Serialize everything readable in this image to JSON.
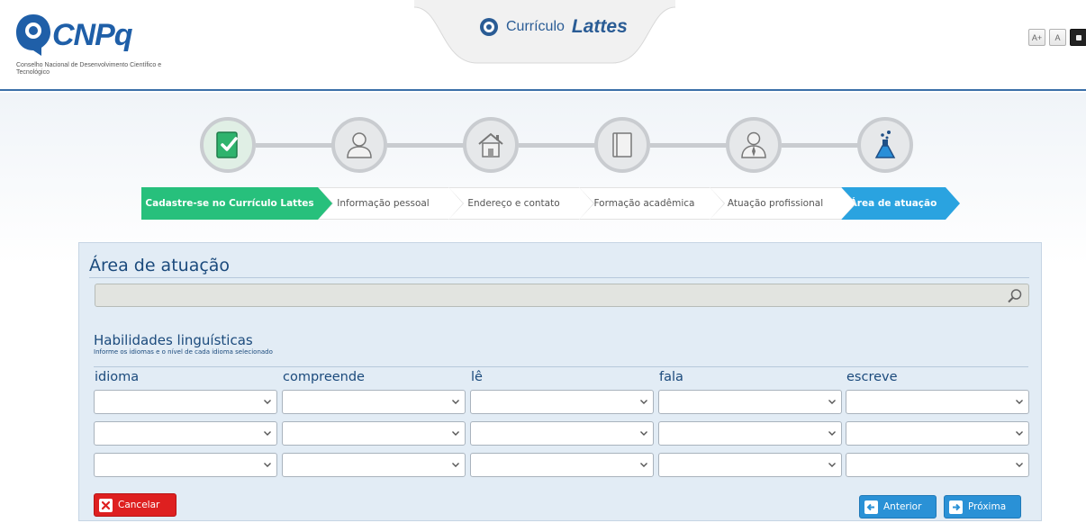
{
  "header": {
    "logo_text": "CNPq",
    "logo_subtitle": "Conselho Nacional de Desenvolvimento Científico e Tecnológico",
    "app_title_prefix": "Currículo",
    "app_title_name": "Lattes",
    "font_controls": [
      "A+",
      "A",
      ""
    ]
  },
  "wizard": {
    "icons": [
      "document-check-icon",
      "person-icon",
      "house-icon",
      "book-icon",
      "professional-icon",
      "flask-icon"
    ],
    "steps": [
      {
        "label": "Cadastre-se no Currículo Lattes",
        "state": "done"
      },
      {
        "label": "Informação pessoal",
        "state": "todo"
      },
      {
        "label": "Endereço e contato",
        "state": "todo"
      },
      {
        "label": "Formação acadêmica",
        "state": "todo"
      },
      {
        "label": "Atuação profissional",
        "state": "todo"
      },
      {
        "label": "Área de atuação",
        "state": "current"
      }
    ]
  },
  "form": {
    "area_title": "Área de atuação",
    "area_search_value": "",
    "hab_title": "Habilidades linguísticas",
    "hab_subtitle": "Informe os idiomas e o nível de cada idioma selecionado",
    "columns": [
      "idioma",
      "compreende",
      "lê",
      "fala",
      "escreve"
    ],
    "rows": [
      [
        "",
        "",
        "",
        "",
        ""
      ],
      [
        "",
        "",
        "",
        "",
        ""
      ],
      [
        "",
        "",
        "",
        "",
        ""
      ]
    ],
    "cancel_label": "Cancelar",
    "prev_label": "Anterior",
    "next_label": "Próxima"
  },
  "colors": {
    "done_step": "#27c07c",
    "current_step": "#2aa3e0",
    "cancel": "#de2020",
    "nav_button": "#2a91d6",
    "brand": "#1f5fa8"
  }
}
